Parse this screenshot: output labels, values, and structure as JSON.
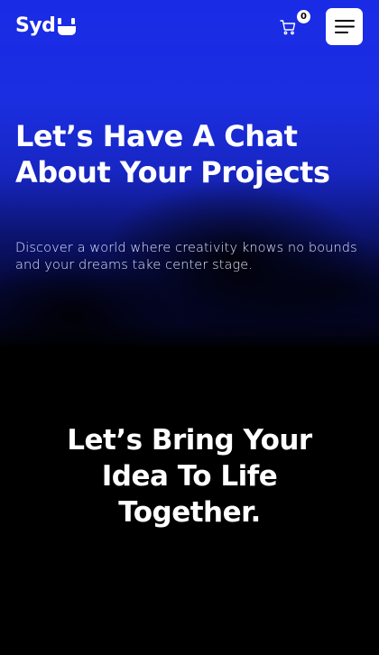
{
  "header": {
    "logo_text": "Syd",
    "logo_mark_icon": "smile-logo-icon",
    "cart_icon": "shopping-cart-icon",
    "cart_count": "0",
    "menu_icon": "hamburger-menu-icon"
  },
  "hero": {
    "title_lines": [
      "Let’s Have A Chat",
      "About Your Projects"
    ],
    "subtitle_lines": [
      "Discover a world where creativity knows no bounds",
      "and your dreams take center stage."
    ]
  },
  "section": {
    "title_lines": [
      "Let’s Bring Your",
      "Idea To Life",
      "Together."
    ]
  },
  "colors": {
    "hero_blue": "#1a2be6",
    "background": "#000000",
    "text": "#ffffff"
  }
}
